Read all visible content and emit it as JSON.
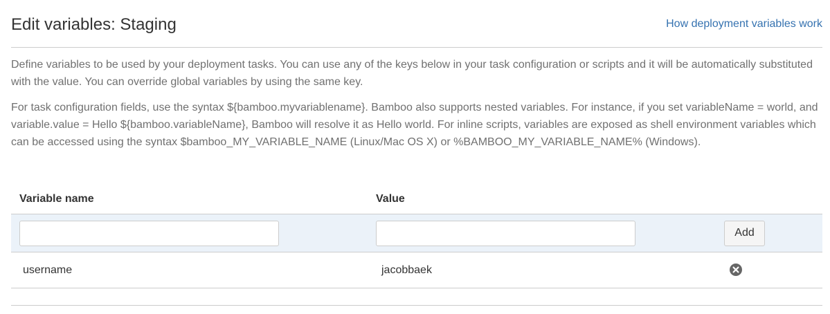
{
  "page": {
    "title": "Edit variables: Staging",
    "help_link": "How deployment variables work"
  },
  "description": {
    "paragraph1": "Define variables to be used by your deployment tasks. You can use any of the keys below in your task configuration or scripts and it will be automatically substituted with the value. You can override global variables by using the same key.",
    "paragraph2": "For task configuration fields, use the syntax ${bamboo.myvariablename}. Bamboo also supports nested variables. For instance, if you set variableName = world, and variable.value = Hello ${bamboo.variableName}, Bamboo will resolve it as Hello world. For inline scripts, variables are exposed as shell environment variables which can be accessed using the syntax $bamboo_MY_VARIABLE_NAME (Linux/Mac OS X) or %BAMBOO_MY_VARIABLE_NAME% (Windows)."
  },
  "table": {
    "headers": {
      "name": "Variable name",
      "value": "Value"
    },
    "new_row": {
      "name_value": "",
      "value_value": "",
      "add_label": "Add"
    },
    "rows": [
      {
        "name": "username",
        "value": "jacobbaek",
        "action_icon": "remove-icon"
      }
    ]
  },
  "colors": {
    "link": "#3572b0",
    "add_row_bg": "#ebf2f9",
    "muted_text": "#707070",
    "border": "#cccccc"
  }
}
